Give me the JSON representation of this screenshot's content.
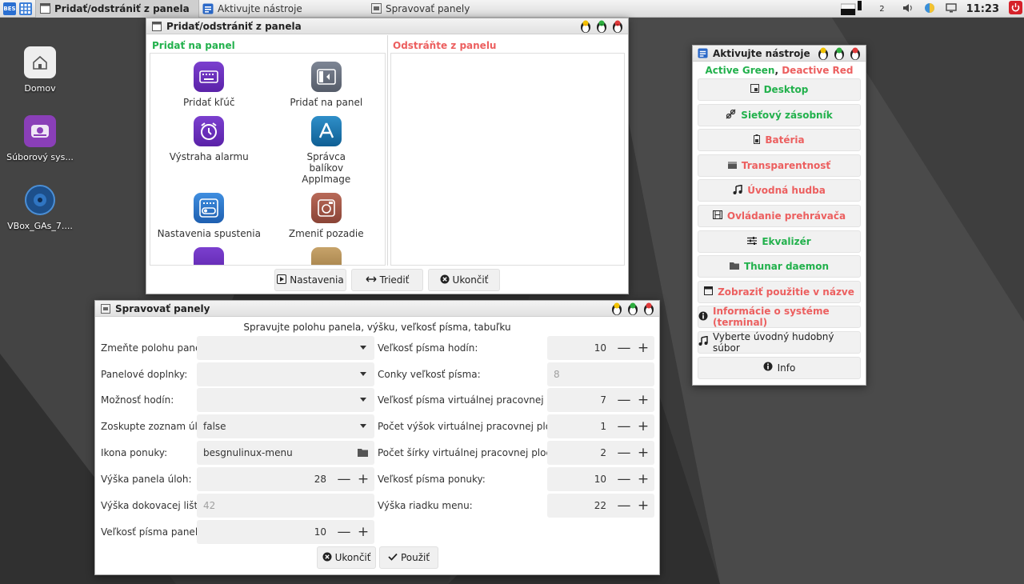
{
  "colors": {
    "active": "#22b14c",
    "deactive": "#ec5f5f",
    "desktop_bg": "#3d3d3d"
  },
  "taskbar": {
    "tasks": [
      {
        "label": "Pridať/odstrániť z panela",
        "icon": "window-icon"
      },
      {
        "label": "Aktivujte nástroje",
        "icon": "tools-icon"
      },
      {
        "label": "Spravovať panely",
        "icon": "window-icon"
      }
    ],
    "workspace_number": "2",
    "clock": "11:23"
  },
  "desktop_icons": [
    {
      "label": "Domov",
      "icon": "home-folder-icon"
    },
    {
      "label": "Súborový sys...",
      "icon": "drive-icon"
    },
    {
      "label": "VBox_GAs_7....",
      "icon": "disc-icon"
    }
  ],
  "add_remove_window": {
    "title": "Pridať/odstrániť z panela",
    "add_header": "Pridať na panel",
    "remove_header": "Odstráňte z panelu",
    "tiles": [
      {
        "label": "Pridať kľúč",
        "icon": "keyboard-icon"
      },
      {
        "label": "Pridať na panel",
        "icon": "panel-icon"
      },
      {
        "label": "Výstraha alarmu",
        "icon": "alarm-clock-icon"
      },
      {
        "label": "Správca balíkov AppImage",
        "icon": "app-store-icon"
      },
      {
        "label": "Nastavenia spustenia",
        "icon": "startup-settings-icon"
      },
      {
        "label": "Zmeniť pozadie",
        "icon": "wallpaper-icon"
      }
    ],
    "buttons": {
      "settings": "Nastavenia",
      "sort": "Triediť",
      "quit": "Ukončiť"
    }
  },
  "tools_window": {
    "title": "Aktivujte nástroje",
    "legend_active": "Active Green",
    "legend_sep": ", ",
    "legend_deactive": "Deactive Red",
    "items": [
      {
        "label": "Desktop",
        "state": "active",
        "icon": "desktop-icon"
      },
      {
        "label": "Sieťový zásobník",
        "state": "active",
        "icon": "network-icon"
      },
      {
        "label": "Batéria",
        "state": "deactive",
        "icon": "battery-icon"
      },
      {
        "label": "Transparentnosť",
        "state": "deactive",
        "icon": "transparency-icon"
      },
      {
        "label": "Úvodná hudba",
        "state": "deactive",
        "icon": "music-note-icon"
      },
      {
        "label": "Ovládanie prehrávača",
        "state": "deactive",
        "icon": "film-icon"
      },
      {
        "label": "Ekvalizér",
        "state": "active",
        "icon": "equalizer-icon"
      },
      {
        "label": "Thunar daemon",
        "state": "active",
        "icon": "folder-icon"
      },
      {
        "label": "Zobraziť použitie v názve",
        "state": "deactive",
        "icon": "window-icon"
      },
      {
        "label": "Informácie o systéme (terminal)",
        "state": "deactive",
        "icon": "info-icon"
      },
      {
        "label": "Vyberte úvodný hudobný súbor",
        "state": "neutral",
        "icon": "music-note-icon"
      },
      {
        "label": "Info",
        "state": "neutral",
        "icon": "info-icon"
      }
    ]
  },
  "manage_window": {
    "title": "Spravovať panely",
    "subtitle": "Spravujte polohu panela, výšku, veľkosť písma, tabuľku",
    "left": {
      "position_label": "Zmeňte polohu panela:",
      "position_value": "",
      "plugins_label": "Panelové doplnky:",
      "plugins_value": "",
      "clock_label": "Možnosť hodín:",
      "clock_value": "",
      "group_label": "Zoskupte zoznam úloh:",
      "group_value": "false",
      "menu_icon_label": "Ikona ponuky:",
      "menu_icon_value": "besgnulinux-menu",
      "taskbar_height_label": "Výška panela úloh:",
      "taskbar_height_value": "28",
      "dock_height_label": "Výška dokovacej lišty:",
      "dock_height_placeholder": "42",
      "panel_font_label": "Veľkosť písma panela:",
      "panel_font_value": "10"
    },
    "right": {
      "clock_font_label": "Veľkosť písma hodín:",
      "clock_font_value": "10",
      "conky_font_label": "Conky veľkosť písma:",
      "conky_font_placeholder": "8",
      "vd_font_label": "Veľkosť písma virtuálnej pracovnej plochy:",
      "vd_font_value": "7",
      "vd_rows_label": "Počet výšok virtuálnej pracovnej plochy:",
      "vd_rows_value": "1",
      "vd_cols_label": "Počet šírky virtuálnej pracovnej plochy:",
      "vd_cols_value": "2",
      "menu_font_label": "Veľkosť písma ponuky:",
      "menu_font_value": "10",
      "menu_row_label": "Výška riadku menu:",
      "menu_row_value": "22"
    },
    "buttons": {
      "quit": "Ukončiť",
      "apply": "Použiť"
    },
    "minus": "—",
    "plus": "+"
  }
}
